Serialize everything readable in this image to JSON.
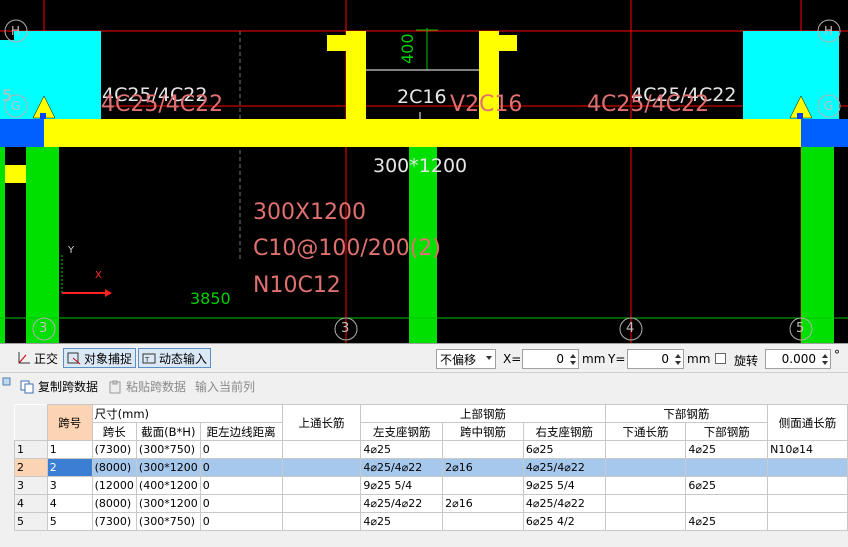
{
  "cad": {
    "axis_labels": [
      "H",
      "H",
      "G",
      "G",
      "3",
      "4",
      "5",
      "3"
    ],
    "annotations": {
      "left_support_a": "4C25/4C22",
      "left_support_b": "4C25/4C22",
      "right_support_a": "4C25/4C22",
      "right_support_b": "4C25/4C22",
      "mid_top": "2C16",
      "mid_top_b": "2C16",
      "mid_top_prefix": "V",
      "section_white": "300*1200",
      "dim_400": "400",
      "dim_3850": "3850",
      "section_red": "300X1200",
      "stirrup": "C10@100/200(2)",
      "side_bar": "N10C12",
      "ucs_x": "X",
      "ucs_y": "Y",
      "side_left": "5"
    },
    "colors": {
      "beam": "#ffff00",
      "column_green": "#00e000",
      "column_cyan": "#00ffff",
      "blue": "#0060ff",
      "axis_line": "#ff0000",
      "annot_red": "#e07070"
    }
  },
  "snapbar": {
    "ortho": "正交",
    "object_snap": "对象捕捉",
    "dynamic_input": "动态输入",
    "offset_mode": "不偏移",
    "x_label": "X=",
    "x_value": "0",
    "x_unit": "mm",
    "y_label": "Y=",
    "y_value": "0",
    "y_unit": "mm",
    "rotate_label": "旋转",
    "rotate_value": "0.000",
    "degree": "°"
  },
  "panel": {
    "toolbar": {
      "copy_span": "复制跨数据",
      "paste_span": "粘贴跨数据",
      "input_current": "输入当前列"
    },
    "headers": {
      "span_no": "跨号",
      "size_group": "尺寸(mm)",
      "span_length": "跨长",
      "section": "截面(B*H)",
      "edge_dist": "距左边线距离",
      "top_through": "上通长筋",
      "top_group": "上部钢筋",
      "left_support": "左支座钢筋",
      "mid_span": "跨中钢筋",
      "right_support": "右支座钢筋",
      "bottom_group": "下部钢筋",
      "bottom_through": "下通长筋",
      "bottom_bar": "下部钢筋",
      "side_through": "侧面通长筋"
    },
    "rows": [
      {
        "idx": "1",
        "span": "1",
        "length": "(7300)",
        "section": "(300*750)",
        "edge": "0",
        "top_through": "",
        "left": "4⌀25",
        "mid": "",
        "right": "6⌀25",
        "bot_through": "",
        "bottom": "4⌀25",
        "side": "N10⌀14"
      },
      {
        "idx": "2",
        "span": "2",
        "length": "(8000)",
        "section": "(300*1200",
        "edge": "0",
        "top_through": "",
        "left": "4⌀25/4⌀22",
        "mid": "2⌀16",
        "right": "4⌀25/4⌀22",
        "bot_through": "",
        "bottom": "",
        "side": ""
      },
      {
        "idx": "3",
        "span": "3",
        "length": "(12000",
        "section": "(400*1200",
        "edge": "0",
        "top_through": "",
        "left": "9⌀25 5/4",
        "mid": "",
        "right": "9⌀25 5/4",
        "bot_through": "",
        "bottom": "6⌀25",
        "side": ""
      },
      {
        "idx": "4",
        "span": "4",
        "length": "(8000)",
        "section": "(300*1200",
        "edge": "0",
        "top_through": "",
        "left": "4⌀25/4⌀22",
        "mid": "2⌀16",
        "right": "4⌀25/4⌀22",
        "bot_through": "",
        "bottom": "",
        "side": ""
      },
      {
        "idx": "5",
        "span": "5",
        "length": "(7300)",
        "section": "(300*750)",
        "edge": "0",
        "top_through": "",
        "left": "4⌀25",
        "mid": "",
        "right": "6⌀25 4/2",
        "bot_through": "",
        "bottom": "4⌀25",
        "side": ""
      }
    ]
  }
}
